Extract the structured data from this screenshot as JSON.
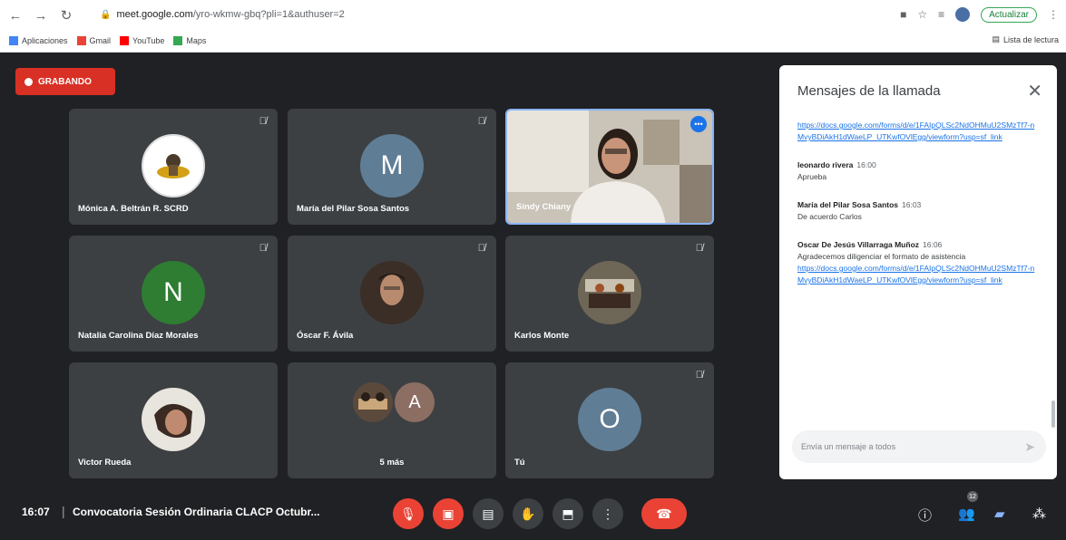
{
  "browser": {
    "url_host": "meet.google.com",
    "url_path": "/yro-wkmw-gbq?pli=1&authuser=2",
    "update_label": "Actualizar",
    "bookmarks": [
      {
        "label": "Aplicaciones"
      },
      {
        "label": "Gmail"
      },
      {
        "label": "YouTube"
      },
      {
        "label": "Maps"
      }
    ],
    "reading_list": "Lista de lectura"
  },
  "meet": {
    "recording_label": "GRABANDO",
    "participants": [
      {
        "name": "Mónica A. Beltrán R. SCRD",
        "initial": "",
        "avatar_color": "#ffffff"
      },
      {
        "name": "María del Pilar Sosa Santos",
        "initial": "M",
        "avatar_color": "#5f7d95"
      },
      {
        "name": "Sindy Chiany",
        "initial": "",
        "avatar_color": ""
      },
      {
        "name": "Natalia Carolina Díaz Morales",
        "initial": "N",
        "avatar_color": "#2e7d32"
      },
      {
        "name": "Óscar F. Ávila",
        "initial": "",
        "avatar_color": "#4e3b2e"
      },
      {
        "name": "Karlos Monte",
        "initial": "",
        "avatar_color": "#5d4a3a"
      },
      {
        "name": "Victor Rueda",
        "initial": "",
        "avatar_color": "#6b5b4e"
      },
      {
        "name": "5 más",
        "initial": "A",
        "avatar_color": "#8d6e63"
      },
      {
        "name": "Tú",
        "initial": "O",
        "avatar_color": "#5f7d95"
      }
    ],
    "clock": "16:07",
    "meeting_title": "Convocatoria Sesión Ordinaria CLACP Octubr...",
    "people_count": "12"
  },
  "chat": {
    "title": "Mensajes de la llamada",
    "messages": [
      {
        "sender": "",
        "time": "",
        "text": "",
        "link": "https://docs.google.com/forms/d/e/1FAIpQLSc2NdOHMuU2SMzTf7-nMvyBDiAkH1dWaeLP_UTKwfOVlEgg/viewform?usp=sf_link"
      },
      {
        "sender": "leonardo rivera",
        "time": "16:00",
        "text": "Aprueba",
        "link": ""
      },
      {
        "sender": "María del Pilar Sosa Santos",
        "time": "16:03",
        "text": "De acuerdo Carlos",
        "link": ""
      },
      {
        "sender": "Oscar De Jesús Villarraga Muñoz",
        "time": "16:06",
        "text": "Agradecemos diligenciar el formato de asistencia",
        "link": "https://docs.google.com/forms/d/e/1FAIpQLSc2NdOHMuU2SMzTf7-nMvyBDiAkH1dWaeLP_UTKwfOVlEgg/viewform?usp=sf_link"
      }
    ],
    "input_placeholder": "Envía un mensaje a todos"
  }
}
